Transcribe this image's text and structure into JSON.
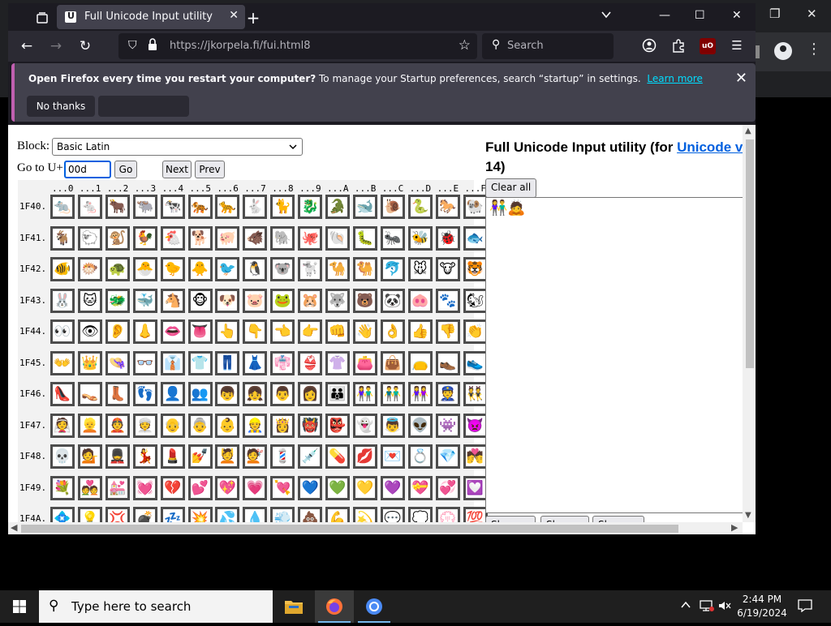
{
  "browser": {
    "tab_title": "Full Unicode Input utility",
    "url": "https://jkorpela.fi/fui.html8",
    "search_placeholder": "Search",
    "ublock_label": "uO"
  },
  "notification": {
    "bold": "Open Firefox every time you restart your computer?",
    "text": " To manage your Startup preferences, search “startup” in settings.",
    "link": "Learn more",
    "no_thanks": "No thanks"
  },
  "page": {
    "block_label": "Block:",
    "block_value": "Basic Latin",
    "goto_label": "Go to U+",
    "goto_value": "00d",
    "go": "Go",
    "next": "Next",
    "prev": "Prev",
    "title_prefix": "Full Unicode Input utility (for ",
    "title_link": "Unicode ve",
    "title_line2": "14)",
    "clear_all": "Clear all",
    "output_text": "👫🙇",
    "show_buttons": [
      "Show U+",
      "Show \\u",
      "Show &#"
    ],
    "column_headers": [
      "...0",
      "...1",
      "...2",
      "...3",
      "...4",
      "...5",
      "...6",
      "...7",
      "...8",
      "...9",
      "...A",
      "...B",
      "...C",
      "...D",
      "...E",
      "...F"
    ],
    "rows": [
      {
        "label": "1F40.",
        "chars": "🐀🐁🐂🐃🐄🐅🐆🐇🐈🐉🐊🐋🐌🐍🐎🐏"
      },
      {
        "label": "1F41.",
        "chars": "🐐🐑🐒🐓🐔🐕🐖🐗🐘🐙🐚🐛🐜🐝🐞🐟"
      },
      {
        "label": "1F42.",
        "chars": "🐠🐡🐢🐣🐤🐥🐦🐧🐨🐩🐪🐫🐬🐭🐮🐯"
      },
      {
        "label": "1F43.",
        "chars": "🐰🐱🐲🐳🐴🐵🐶🐷🐸🐹🐺🐻🐼🐽🐾🐿"
      },
      {
        "label": "1F44.",
        "chars": "👀👁👂👃👄👅👆👇👈👉👊👋👌👍👎👏"
      },
      {
        "label": "1F45.",
        "chars": "👐👑👒👓👔👕👖👗👘👙👚👛👜👝👞👟"
      },
      {
        "label": "1F46.",
        "chars": "👠👡👢👣👤👥👦👧👨👩👪👫👬👭👮👯"
      },
      {
        "label": "1F47.",
        "chars": "👰👱👲👳👴👵👶👷👸👹👺👻👼👽👾👿"
      },
      {
        "label": "1F48.",
        "chars": "💀💁💂💃💄💅💆💇💈💉💊💋💌💍💎💏"
      },
      {
        "label": "1F49.",
        "chars": "💐💑💒💓💔💕💖💗💘💙💚💛💜💝💞💟"
      },
      {
        "label": "1F4A.",
        "chars": "💠💡💢💣💤💥💦💧💨💩💪💫💬💭💮💯"
      }
    ]
  },
  "taskbar": {
    "search_placeholder": "Type here to search",
    "time": "2:44 PM",
    "date": "6/19/2024"
  },
  "colors": {
    "accent": "#0060df",
    "firefox_dark": "#1c1b22",
    "notif_link": "#00ddff"
  }
}
